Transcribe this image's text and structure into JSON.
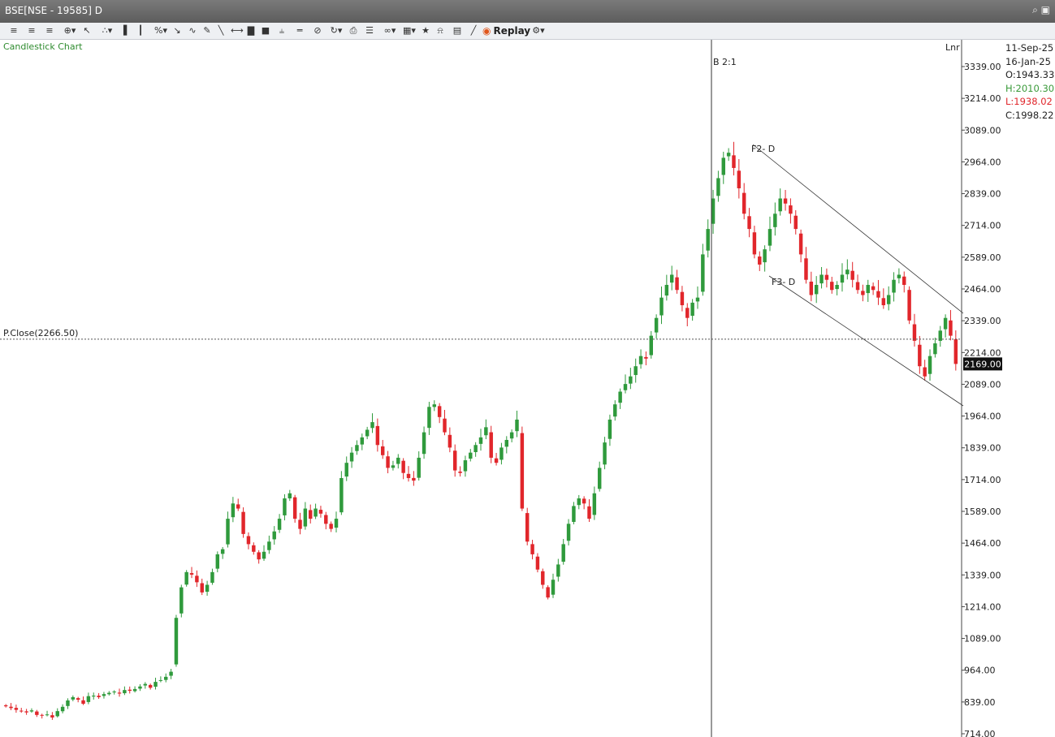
{
  "window": {
    "title": "BSE[NSE - 19585] D"
  },
  "toolbar": {
    "replay_label": "Replay"
  },
  "chart_data": {
    "type": "candlestick",
    "title": "Candlestick Chart",
    "scale_label": "Lnr",
    "ylim": [
      714,
      3339
    ],
    "yticks": [
      "3339.00",
      "3214.00",
      "3089.00",
      "2964.00",
      "2839.00",
      "2714.00",
      "2589.00",
      "2464.00",
      "2339.00",
      "2214.00",
      "2089.00",
      "1964.00",
      "1839.00",
      "1714.00",
      "1589.00",
      "1464.00",
      "1339.00",
      "1214.00",
      "1089.00",
      "964.00",
      "839.00",
      "714.00"
    ],
    "prev_close_label": "P.Close(2266.50)",
    "prev_close": 2266.5,
    "last_price_label": "2169.00",
    "last_price": 2169,
    "event_label": "B 2:1",
    "annotations": [
      "F2- D",
      "F3- D"
    ],
    "info": {
      "date1": "11-Sep-25",
      "date2": "16-Jan-25",
      "open": "O:1943.33",
      "high": "H:2010.30",
      "low": "L:1938.02",
      "close": "C:1998.22"
    },
    "closes": [
      822,
      815,
      808,
      803,
      798,
      806,
      788,
      785,
      790,
      778,
      803,
      820,
      845,
      858,
      848,
      832,
      862,
      864,
      858,
      870,
      875,
      880,
      872,
      886,
      883,
      890,
      900,
      910,
      895,
      918,
      925,
      938,
      958,
      1170,
      1290,
      1350,
      1340,
      1310,
      1270,
      1300,
      1350,
      1420,
      1440,
      1560,
      1620,
      1600,
      1500,
      1460,
      1430,
      1400,
      1430,
      1470,
      1510,
      1560,
      1640,
      1660,
      1560,
      1520,
      1600,
      1560,
      1600,
      1580,
      1540,
      1520,
      1560,
      1720,
      1780,
      1820,
      1850,
      1880,
      1910,
      1940,
      1850,
      1810,
      1760,
      1770,
      1800,
      1740,
      1720,
      1710,
      1800,
      1900,
      2000,
      2010,
      1960,
      1900,
      1840,
      1750,
      1740,
      1790,
      1820,
      1850,
      1880,
      1920,
      1800,
      1780,
      1840,
      1870,
      1900,
      1950,
      1600,
      1470,
      1420,
      1360,
      1300,
      1250,
      1320,
      1380,
      1460,
      1540,
      1610,
      1640,
      1620,
      1560,
      1660,
      1760,
      1860,
      1950,
      2010,
      2060,
      2090,
      2120,
      2160,
      2200,
      2190,
      2280,
      2350,
      2430,
      2480,
      2520,
      2460,
      2400,
      2350,
      2410,
      2430,
      2600,
      2700,
      2820,
      2900,
      2980,
      3000,
      2940,
      2860,
      2760,
      2700,
      2600,
      2560,
      2620,
      2700,
      2760,
      2820,
      2800,
      2760,
      2700,
      2600,
      2500,
      2440,
      2480,
      2520,
      2500,
      2460,
      2480,
      2520,
      2540,
      2500,
      2460,
      2440,
      2480,
      2460,
      2430,
      2400,
      2440,
      2500,
      2520,
      2480,
      2340,
      2260,
      2160,
      2120,
      2200,
      2250,
      2300,
      2350,
      2280,
      2169
    ]
  }
}
